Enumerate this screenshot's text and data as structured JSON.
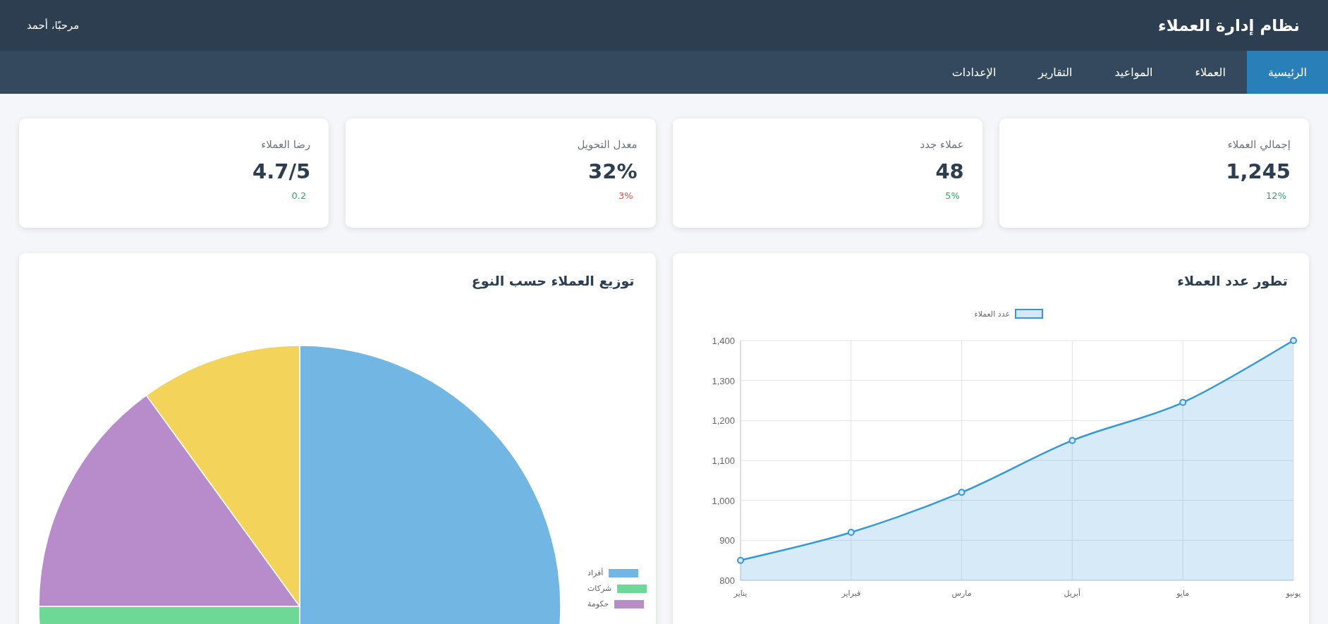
{
  "header": {
    "title": "نظام إدارة العملاء",
    "greeting": "مرحبًا، أحمد"
  },
  "tabs": [
    {
      "label": "الرئيسية",
      "selected": true
    },
    {
      "label": "العملاء",
      "selected": false
    },
    {
      "label": "المواعيد",
      "selected": false
    },
    {
      "label": "التقارير",
      "selected": false
    },
    {
      "label": "الإعدادات",
      "selected": false
    }
  ],
  "stats": [
    {
      "label": "إجمالي العملاء",
      "value": "1,245",
      "change": "12%",
      "color": "#27ae60"
    },
    {
      "label": "عملاء جدد",
      "value": "48",
      "change": "5%",
      "color": "#27ae60"
    },
    {
      "label": "معدل التحويل",
      "value": "32%",
      "change": "3%",
      "color": "#e74c3c"
    },
    {
      "label": "رضا العملاء",
      "value": "4.7/5",
      "change": "0.2",
      "color": "#27ae60"
    }
  ],
  "growth_chart": {
    "title": "تطور عدد العملاء",
    "chart_data": {
      "type": "area",
      "grid": true,
      "categories": [
        "يناير",
        "فبراير",
        "مارس",
        "أبريل",
        "مايو",
        "يونيو"
      ],
      "series": [
        {
          "name": "عدد العملاء",
          "color": "#3498db",
          "values": [
            850,
            920,
            1020,
            1150,
            1245,
            1400
          ]
        }
      ],
      "ylim": [
        800,
        1400
      ],
      "yticks": [
        {
          "value": 800,
          "label": "800"
        },
        {
          "value": 900,
          "label": "900"
        },
        {
          "value": 1000,
          "label": "1,000"
        },
        {
          "value": 1100,
          "label": "1,100"
        },
        {
          "value": 1200,
          "label": "1,200"
        },
        {
          "value": 1300,
          "label": "1,300"
        },
        {
          "value": 1400,
          "label": "1,400"
        }
      ]
    }
  },
  "type_chart": {
    "title": "توزيع العملاء حسب النوع",
    "chart_data": {
      "type": "pie",
      "values": [
        50,
        25,
        15,
        10
      ],
      "colors": [
        "#72b6e4",
        "#6ed896",
        "#b88bcb",
        "#f4d35a"
      ]
    },
    "legend": [
      {
        "label": "أفراد",
        "color": "#72b6e4"
      },
      {
        "label": "شركات",
        "color": "#6ed896"
      },
      {
        "label": "حكومة",
        "color": "#b88bcb"
      }
    ]
  }
}
